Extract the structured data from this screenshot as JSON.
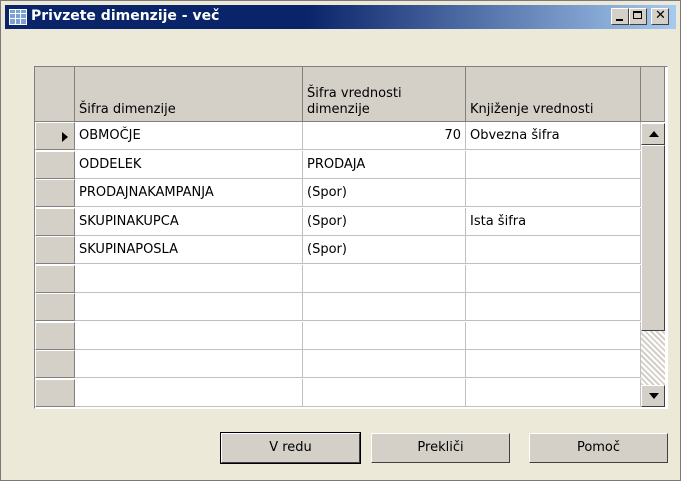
{
  "window": {
    "title": "Privzete dimenzije - več",
    "icon": "table-icon"
  },
  "table": {
    "columns": [
      "Šifra dimenzije",
      "Šifra vrednosti\ndimenzije",
      "Knjiženje vrednosti"
    ],
    "rows": [
      {
        "dimension_code": "OBMOČJE",
        "value_code": "70",
        "value_posting": "Obvezna šifra",
        "selected": true
      },
      {
        "dimension_code": "ODDELEK",
        "value_code": "PRODAJA",
        "value_posting": ""
      },
      {
        "dimension_code": "PRODAJNAKAMPANJA",
        "value_code": "(Spor)",
        "value_posting": ""
      },
      {
        "dimension_code": "SKUPINAKUPCA",
        "value_code": "(Spor)",
        "value_posting": "Ista šifra"
      },
      {
        "dimension_code": "SKUPINAPOSLA",
        "value_code": "(Spor)",
        "value_posting": ""
      }
    ],
    "total_visible_rows": 10
  },
  "buttons": {
    "ok": "V redu",
    "cancel": "Prekliči",
    "help": "Pomoč"
  }
}
